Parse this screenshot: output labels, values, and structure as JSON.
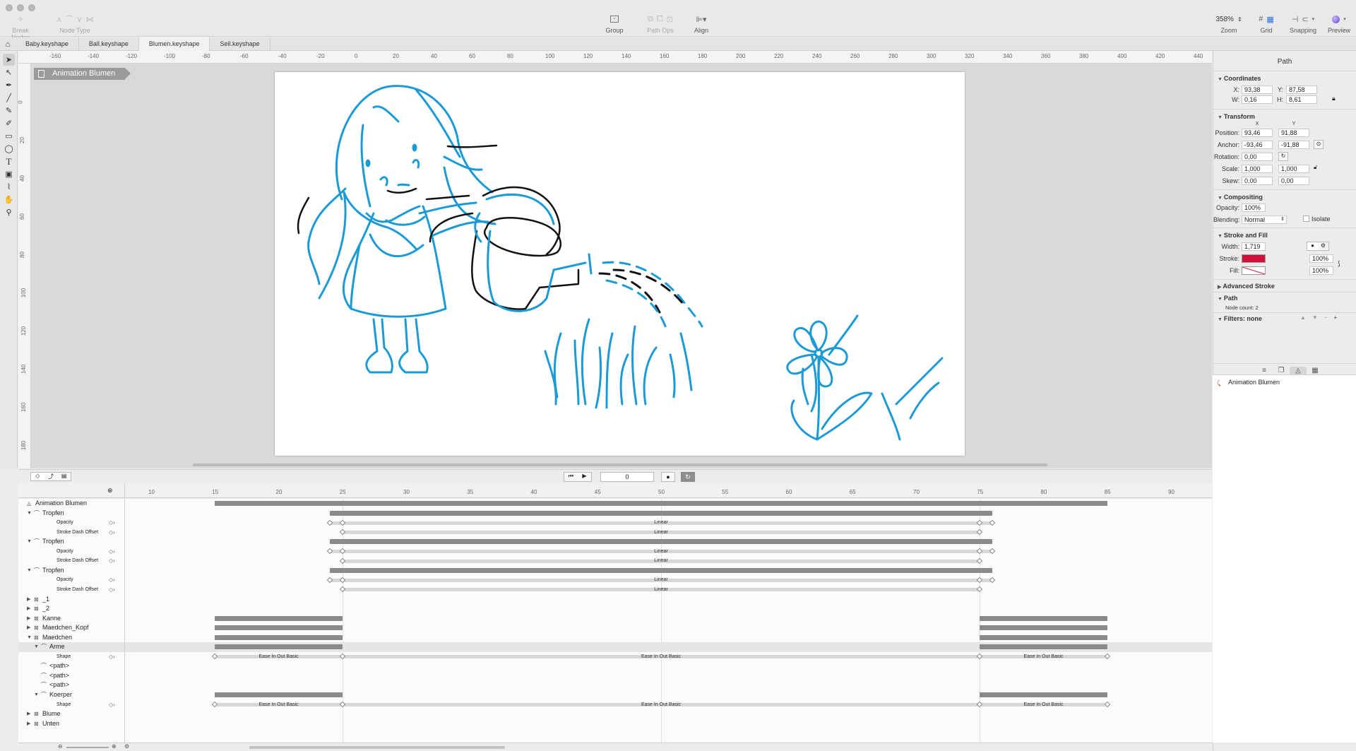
{
  "toolbar": {
    "left_groups": [
      {
        "label": "Break Nodes"
      },
      {
        "label": "Node Type"
      }
    ],
    "center_groups": [
      {
        "label": "Group"
      },
      {
        "label": "Path Ops"
      },
      {
        "label": "Align"
      }
    ],
    "zoom": {
      "value": "358%",
      "label": "Zoom"
    },
    "right_groups": [
      {
        "label": "Grid"
      },
      {
        "label": "Snapping"
      },
      {
        "label": "Preview"
      }
    ]
  },
  "tabs": [
    {
      "label": "Baby.keyshape",
      "active": false
    },
    {
      "label": "Ball.keyshape",
      "active": false
    },
    {
      "label": "Blumen.keyshape",
      "active": true
    },
    {
      "label": "Seil.keyshape",
      "active": false
    }
  ],
  "tools": [
    "select-icon",
    "direct-select-icon",
    "pen-icon",
    "line-icon",
    "pencil-icon",
    "fill-pen-icon",
    "rectangle-icon",
    "ellipse-icon",
    "text-icon",
    "image-icon",
    "eyedropper-icon",
    "hand-icon",
    "zoom-icon"
  ],
  "ruler": {
    "h": [
      "-160",
      "-140",
      "-120",
      "-100",
      "-80",
      "-60",
      "-40",
      "-20",
      "0",
      "20",
      "40",
      "60",
      "80",
      "100",
      "120",
      "140",
      "160",
      "180",
      "200",
      "220",
      "240",
      "260",
      "280",
      "300",
      "320",
      "340",
      "360",
      "380",
      "400",
      "420",
      "440"
    ],
    "v": [
      "0",
      "20",
      "40",
      "60",
      "80",
      "100",
      "120",
      "140",
      "160",
      "180"
    ]
  },
  "canvas": {
    "breadcrumb": "Animation Blumen"
  },
  "inspector": {
    "title": "Path",
    "coordinates": {
      "title": "Coordinates",
      "x_label": "X:",
      "x": "93,38",
      "y_label": "Y:",
      "y": "87,58",
      "w_label": "W:",
      "w": "0,16",
      "h_label": "H:",
      "h": "8,61"
    },
    "transform": {
      "title": "Transform",
      "col_x": "X",
      "col_y": "Y",
      "position_label": "Position:",
      "position_x": "93,46",
      "position_y": "91,88",
      "anchor_label": "Anchor:",
      "anchor_x": "-93,46",
      "anchor_y": "-91,88",
      "rotation_label": "Rotation:",
      "rotation": "0,00",
      "scale_label": "Scale:",
      "scale_x": "1,000",
      "scale_y": "1,000",
      "skew_label": "Skew:",
      "skew_x": "0,00",
      "skew_y": "0,00"
    },
    "compositing": {
      "title": "Compositing",
      "opacity_label": "Opacity:",
      "opacity": "100%",
      "blending_label": "Blending:",
      "blending": "Normal",
      "isolate": "Isolate"
    },
    "stroke_fill": {
      "title": "Stroke and Fill",
      "width_label": "Width:",
      "width": "1,719",
      "stroke_label": "Stroke:",
      "stroke_color": "#d0103a",
      "stroke_opacity": "100%",
      "fill_label": "Fill:",
      "fill_opacity": "100%"
    },
    "advanced_stroke": "Advanced Stroke",
    "path": {
      "title": "Path",
      "node_count": "Node count: 2"
    },
    "filters": "Filters: none",
    "layer": "Animation Blumen"
  },
  "timeline": {
    "frame": "0",
    "ticks": [
      "10",
      "15",
      "20",
      "25",
      "30",
      "35",
      "40",
      "45",
      "50",
      "55",
      "60",
      "65",
      "70",
      "75",
      "80",
      "85",
      "90"
    ],
    "rows": [
      {
        "name": "Animation Blumen",
        "level": 0,
        "kind": "root"
      },
      {
        "name": "Tropfen",
        "level": 1,
        "kind": "group-open"
      },
      {
        "name": "Opacity",
        "level": 3,
        "kind": "prop"
      },
      {
        "name": "Stroke Dash Offset",
        "level": 3,
        "kind": "prop"
      },
      {
        "name": "Tropfen",
        "level": 1,
        "kind": "group-open"
      },
      {
        "name": "Opacity",
        "level": 3,
        "kind": "prop"
      },
      {
        "name": "Stroke Dash Offset",
        "level": 3,
        "kind": "prop"
      },
      {
        "name": "Tropfen",
        "level": 1,
        "kind": "group-open"
      },
      {
        "name": "Opacity",
        "level": 3,
        "kind": "prop"
      },
      {
        "name": "Stroke Dash Offset",
        "level": 3,
        "kind": "prop"
      },
      {
        "name": "_1",
        "level": 1,
        "kind": "layer"
      },
      {
        "name": "_2",
        "level": 1,
        "kind": "layer"
      },
      {
        "name": "Kanne",
        "level": 1,
        "kind": "layer"
      },
      {
        "name": "Maedchen_Kopf",
        "level": 1,
        "kind": "layer"
      },
      {
        "name": "Maedchen",
        "level": 1,
        "kind": "layer-open"
      },
      {
        "name": "Arme",
        "level": 2,
        "kind": "group-open",
        "selected": true
      },
      {
        "name": "Shape",
        "level": 3,
        "kind": "prop"
      },
      {
        "name": "<path>",
        "level": 2,
        "kind": "path"
      },
      {
        "name": "<path>",
        "level": 2,
        "kind": "path"
      },
      {
        "name": "<path>",
        "level": 2,
        "kind": "path"
      },
      {
        "name": "Koerper",
        "level": 2,
        "kind": "group-open"
      },
      {
        "name": "Shape",
        "level": 3,
        "kind": "prop"
      },
      {
        "name": "Blume",
        "level": 1,
        "kind": "layer"
      },
      {
        "name": "Unten",
        "level": 1,
        "kind": "layer"
      }
    ],
    "ease_linear": "Linear",
    "ease_basic": "Ease In Out Basic"
  }
}
